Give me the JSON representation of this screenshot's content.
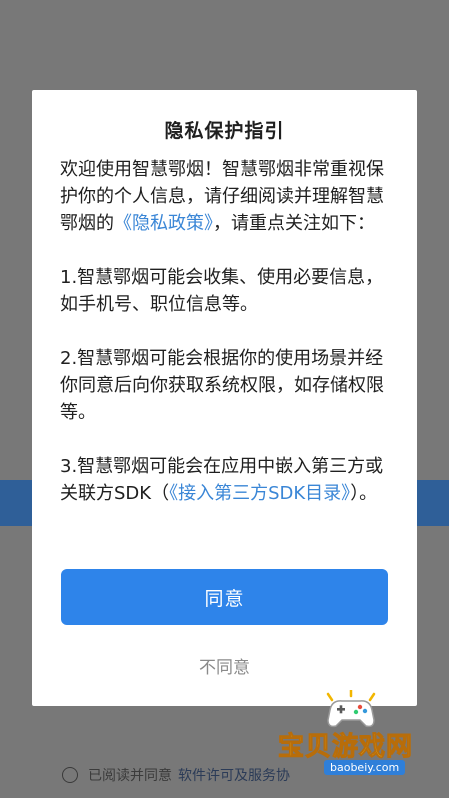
{
  "dialog": {
    "title": "隐私保护指引",
    "intro_part1": "欢迎使用智慧鄂烟！智慧鄂烟非常重视保护你的个人信息，请仔细阅读并理解智慧鄂烟的",
    "intro_link": "《隐私政策》",
    "intro_part2": "，请重点关注如下：",
    "item1": "1.智慧鄂烟可能会收集、使用必要信息，如手机号、职位信息等。",
    "item2": "2.智慧鄂烟可能会根据你的使用场景并经你同意后向你获取系统权限，如存储权限等。",
    "item3_part1": "3.智慧鄂烟可能会在应用中嵌入第三方或关联方SDK（",
    "item3_link": "《接入第三方SDK目录》",
    "item3_part2": "）。",
    "agree_label": "同意",
    "disagree_label": "不同意"
  },
  "background": {
    "consent_text": "已阅读并同意",
    "consent_link": "软件许可及服务协"
  },
  "watermark": {
    "brand": "宝贝游戏网",
    "url": "baobeiy.com"
  },
  "colors": {
    "primary": "#2e84ea",
    "link": "#3a86d6",
    "overlay": "#787878"
  }
}
